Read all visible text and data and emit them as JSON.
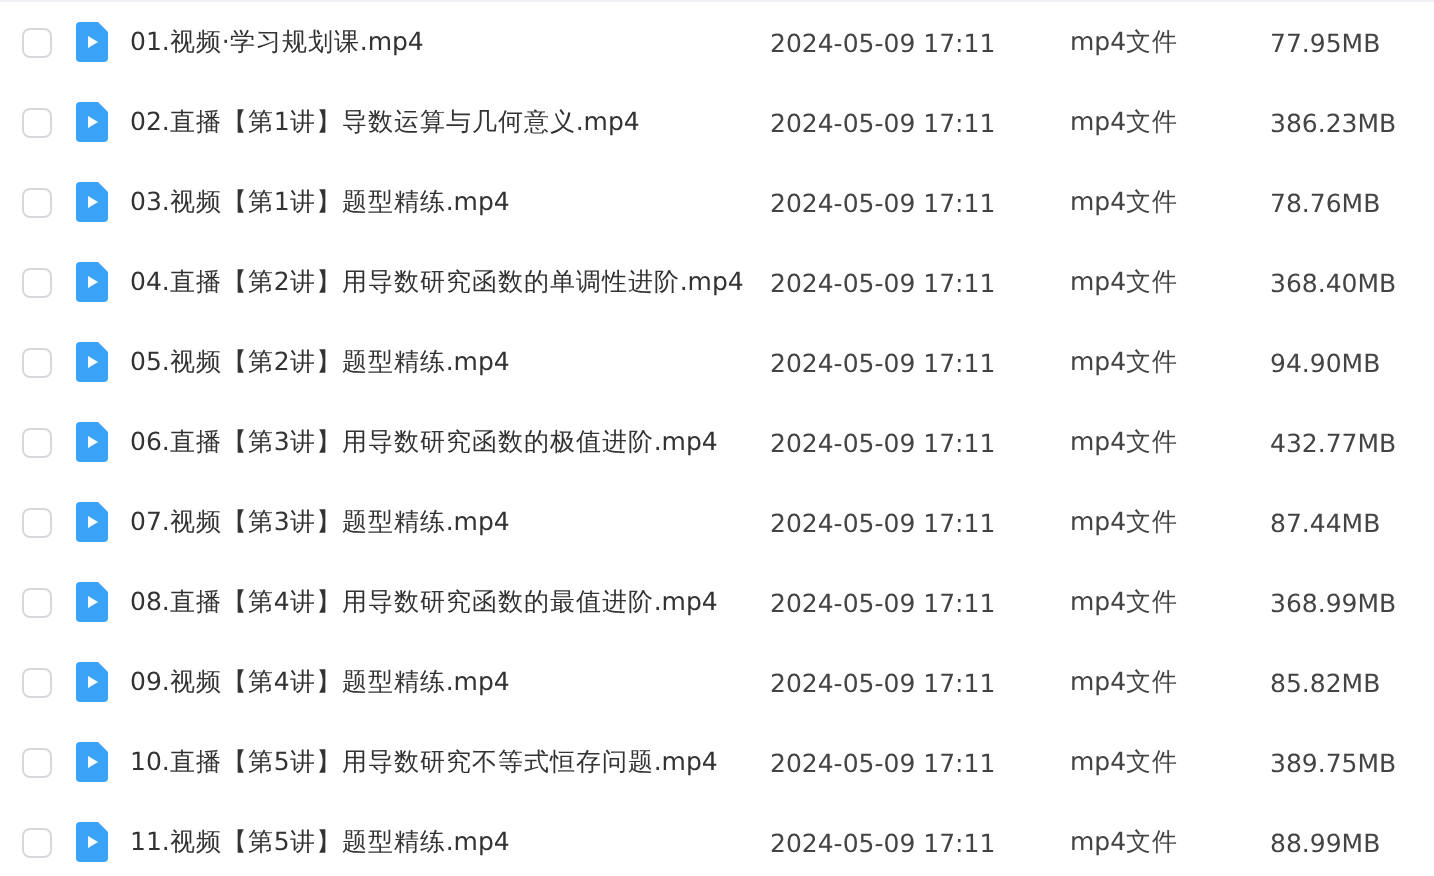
{
  "files": [
    {
      "name": "01.视频·学习规划课.mp4",
      "date": "2024-05-09 17:11",
      "type": "mp4文件",
      "size": "77.95MB",
      "checked": false
    },
    {
      "name": "02.直播【第1讲】导数运算与几何意义.mp4",
      "date": "2024-05-09 17:11",
      "type": "mp4文件",
      "size": "386.23MB",
      "checked": false
    },
    {
      "name": "03.视频【第1讲】题型精练.mp4",
      "date": "2024-05-09 17:11",
      "type": "mp4文件",
      "size": "78.76MB",
      "checked": false
    },
    {
      "name": "04.直播【第2讲】用导数研究函数的单调性进阶.mp4",
      "date": "2024-05-09 17:11",
      "type": "mp4文件",
      "size": "368.40MB",
      "checked": false
    },
    {
      "name": "05.视频【第2讲】题型精练.mp4",
      "date": "2024-05-09 17:11",
      "type": "mp4文件",
      "size": "94.90MB",
      "checked": false
    },
    {
      "name": "06.直播【第3讲】用导数研究函数的极值进阶.mp4",
      "date": "2024-05-09 17:11",
      "type": "mp4文件",
      "size": "432.77MB",
      "checked": false
    },
    {
      "name": "07.视频【第3讲】题型精练.mp4",
      "date": "2024-05-09 17:11",
      "type": "mp4文件",
      "size": "87.44MB",
      "checked": false
    },
    {
      "name": "08.直播【第4讲】用导数研究函数的最值进阶.mp4",
      "date": "2024-05-09 17:11",
      "type": "mp4文件",
      "size": "368.99MB",
      "checked": false
    },
    {
      "name": "09.视频【第4讲】题型精练.mp4",
      "date": "2024-05-09 17:11",
      "type": "mp4文件",
      "size": "85.82MB",
      "checked": false
    },
    {
      "name": "10.直播【第5讲】用导数研究不等式恒存问题.mp4",
      "date": "2024-05-09 17:11",
      "type": "mp4文件",
      "size": "389.75MB",
      "checked": false
    },
    {
      "name": "11.视频【第5讲】题型精练.mp4",
      "date": "2024-05-09 17:11",
      "type": "mp4文件",
      "size": "88.99MB",
      "checked": false
    }
  ]
}
